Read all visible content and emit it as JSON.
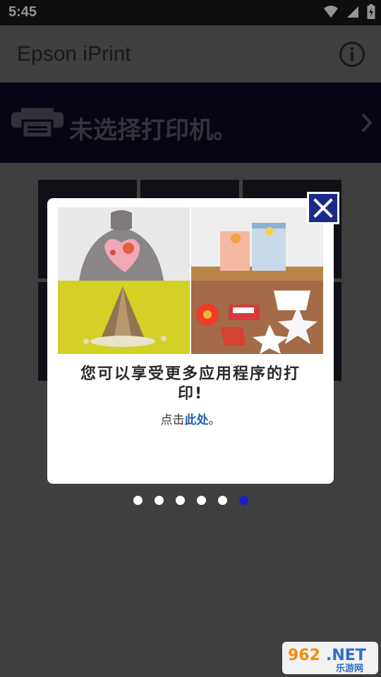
{
  "status_bar": {
    "time": "5:45",
    "icons": [
      "wifi-icon",
      "signal-icon",
      "battery-charging-icon"
    ]
  },
  "app_bar": {
    "title": "Epson iPrint",
    "info_icon": "info-icon"
  },
  "printer": {
    "label": "未选择打印机。",
    "icon": "printer-icon"
  },
  "popup": {
    "title": "您可以享受更多应用程序的打印!",
    "subtitle_prefix": "点击",
    "link": "此处",
    "subtitle_suffix": "。",
    "close_icon": "close-icon"
  },
  "pager": {
    "total": 6,
    "active_index": 5
  },
  "watermark": {
    "text_top": "962.NET",
    "text_bottom": "乐游网"
  },
  "colors": {
    "accent_blue": "#1b2a8a",
    "link_blue": "#1f5fb0",
    "active_dot": "#1d1dc2"
  }
}
